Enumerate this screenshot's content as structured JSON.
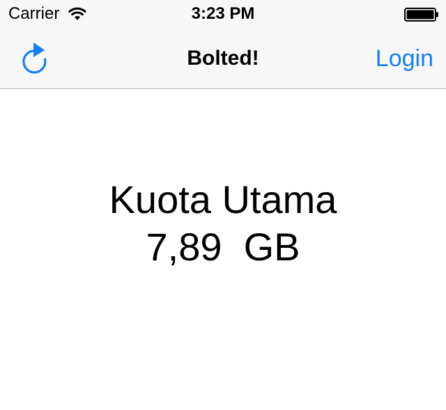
{
  "status_bar": {
    "carrier": "Carrier",
    "time": "3:23 PM",
    "wifi_icon": "wifi-icon",
    "battery_icon": "battery-icon"
  },
  "nav_bar": {
    "left_icon": "refresh-icon",
    "title": "Bolted!",
    "right_button": "Login",
    "tint_color": "#157efb"
  },
  "main": {
    "quota_label": "Kuota Utama",
    "quota_value": "7,89  GB"
  }
}
